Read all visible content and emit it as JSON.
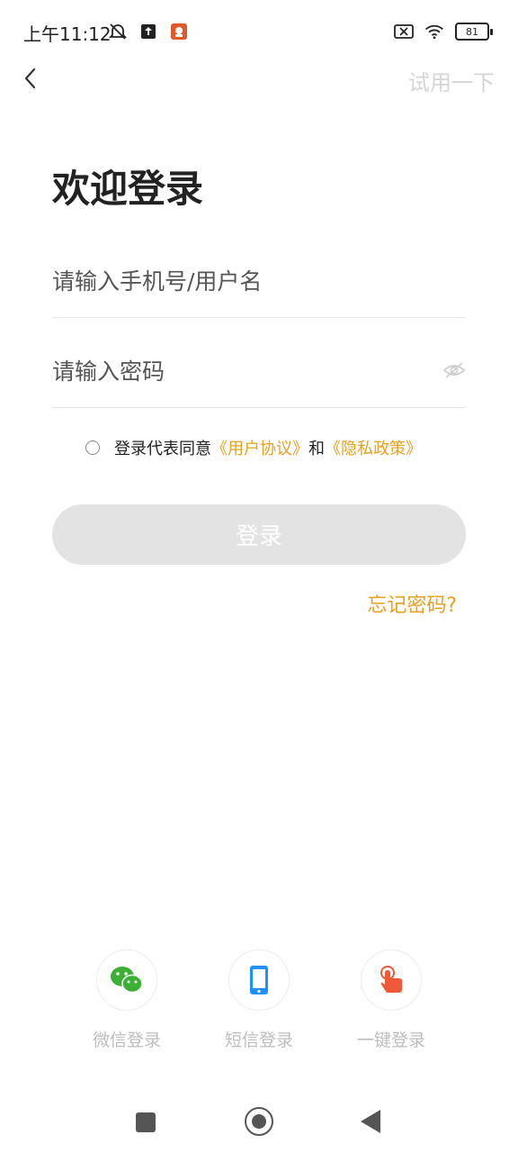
{
  "status_bar": {
    "time": "上午11:12",
    "battery": "81"
  },
  "nav": {
    "try_label": "试用一下"
  },
  "title": "欢迎登录",
  "form": {
    "phone_placeholder": "请输入手机号/用户名",
    "password_placeholder": "请输入密码"
  },
  "agreement": {
    "prefix": "登录代表同意",
    "user_agreement": "《用户协议》",
    "and": "和",
    "privacy_policy": "《隐私政策》"
  },
  "login_button": "登录",
  "forgot_password": "忘记密码?",
  "login_options": [
    {
      "label": "微信登录",
      "icon": "wechat-icon"
    },
    {
      "label": "短信登录",
      "icon": "phone-icon"
    },
    {
      "label": "一键登录",
      "icon": "tap-icon"
    }
  ],
  "colors": {
    "accent": "#e6a11f",
    "wechat": "#3cb034",
    "sms": "#1e90ff",
    "one_tap": "#f0583a"
  }
}
